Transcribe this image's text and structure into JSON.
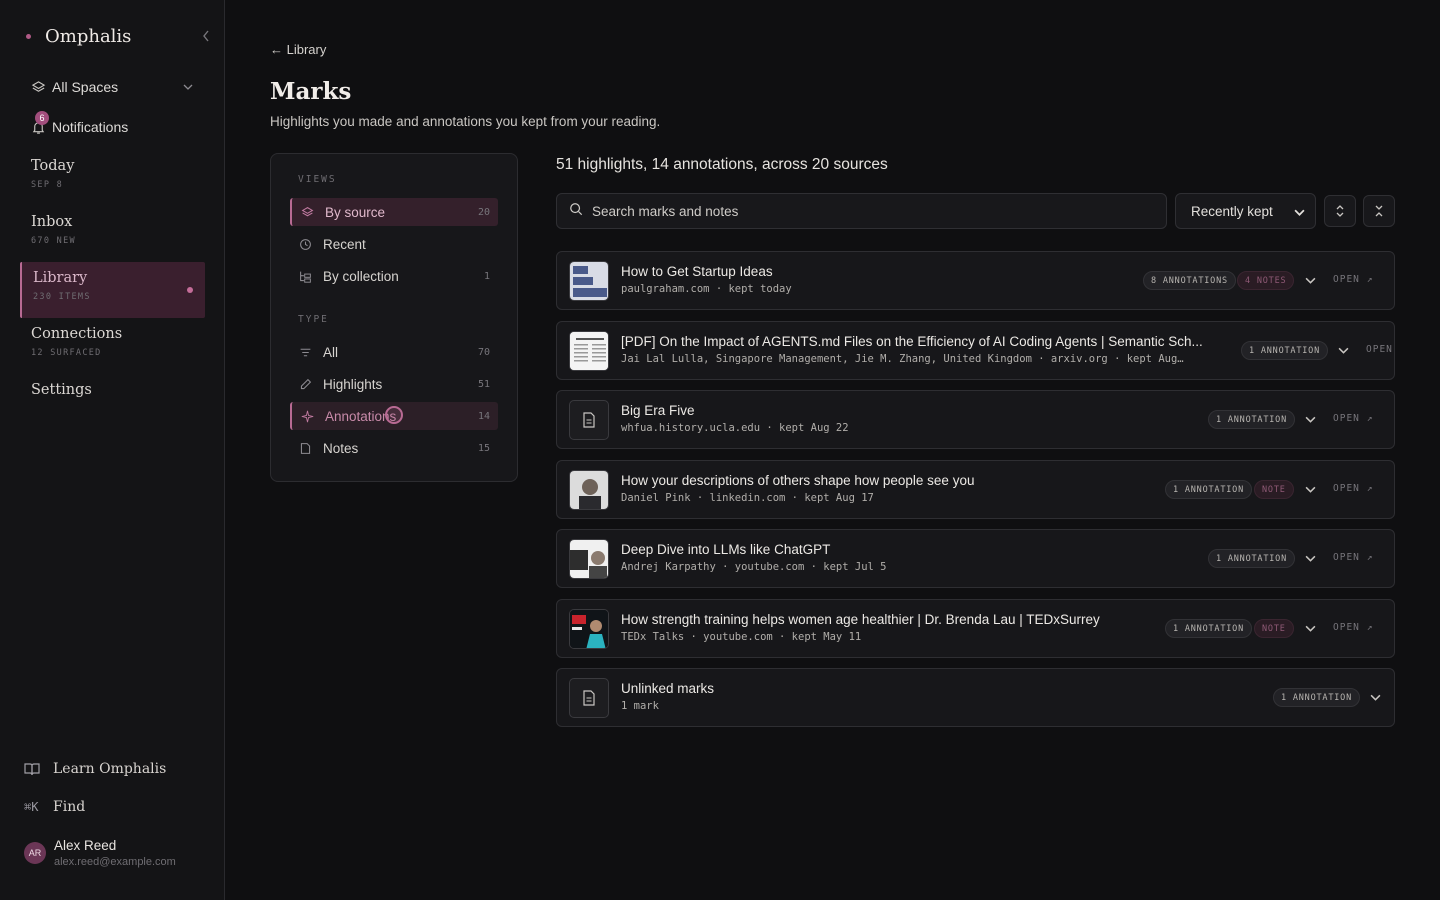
{
  "brand": {
    "name": "Omphalis"
  },
  "nav_top": {
    "spaces_label": "All Spaces",
    "notifications_label": "Notifications",
    "notifications_badge": "6"
  },
  "nav": [
    {
      "label": "Today",
      "sub": "SEP 8"
    },
    {
      "label": "Inbox",
      "sub": "670 NEW"
    },
    {
      "label": "Library",
      "sub": "230 ITEMS"
    },
    {
      "label": "Connections",
      "sub": "12 SURFACED"
    },
    {
      "label": "Settings"
    }
  ],
  "nav_bottom": {
    "learn_label": "Learn Omphalis",
    "find_label": "Find",
    "find_kbd": "⌘K"
  },
  "user": {
    "initials": "AR",
    "name": "Alex Reed",
    "email": "alex.reed@example.com"
  },
  "header": {
    "back_label": "Library",
    "title": "Marks",
    "subtitle": "Highlights you made and annotations you kept from your reading."
  },
  "views_panel": {
    "views_heading": "VIEWS",
    "views": [
      {
        "label": "By source",
        "count": "20"
      },
      {
        "label": "Recent",
        "count": ""
      },
      {
        "label": "By collection",
        "count": "1"
      }
    ],
    "type_heading": "TYPE",
    "types": [
      {
        "label": "All",
        "count": "70"
      },
      {
        "label": "Highlights",
        "count": "51"
      },
      {
        "label": "Annotations",
        "count": "14"
      },
      {
        "label": "Notes",
        "count": "15"
      }
    ]
  },
  "summary": "51 highlights, 14 annotations, across 20 sources",
  "search": {
    "placeholder": "Search marks and notes"
  },
  "sort": {
    "selected": "Recently kept"
  },
  "colors": {
    "accent": "#b86a93",
    "background": "#0f0f11",
    "card": "#17171a"
  },
  "open_label": "OPEN",
  "sources": [
    {
      "title": "How to Get Startup Ideas",
      "meta": "paulgraham.com · kept today",
      "annotations": "8 ANNOTATIONS",
      "notes": "4 NOTES",
      "thumb": "article-thumb"
    },
    {
      "title": "[PDF] On the Impact of AGENTS.md Files on the Efficiency of AI Coding Agents | Semantic Sch...",
      "meta": "Jai Lal Lulla, Singapore Management, Jie M. Zhang, United Kingdom · arxiv.org · kept Aug…",
      "annotations": "1 ANNOTATION",
      "notes": "",
      "thumb": "paper-thumb"
    },
    {
      "title": "Big Era Five",
      "meta": "whfua.history.ucla.edu · kept Aug 22",
      "annotations": "1 ANNOTATION",
      "notes": "",
      "thumb": "document-icon"
    },
    {
      "title": "How your descriptions of others shape how people see you",
      "meta": "Daniel Pink · linkedin.com · kept Aug 17",
      "annotations": "1 ANNOTATION",
      "notes": "NOTE",
      "thumb": "portrait-thumb"
    },
    {
      "title": "Deep Dive into LLMs like ChatGPT",
      "meta": "Andrej Karpathy · youtube.com · kept Jul 5",
      "annotations": "1 ANNOTATION",
      "notes": "",
      "thumb": "video-thumb"
    },
    {
      "title": "How strength training helps women age healthier | Dr. Brenda Lau | TEDxSurrey",
      "meta": "TEDx Talks · youtube.com · kept May 11",
      "annotations": "1 ANNOTATION",
      "notes": "NOTE",
      "thumb": "ted-thumb"
    },
    {
      "title": "Unlinked marks",
      "meta": "1 mark",
      "annotations": "1 ANNOTATION",
      "notes": "",
      "thumb": "document-icon"
    }
  ]
}
